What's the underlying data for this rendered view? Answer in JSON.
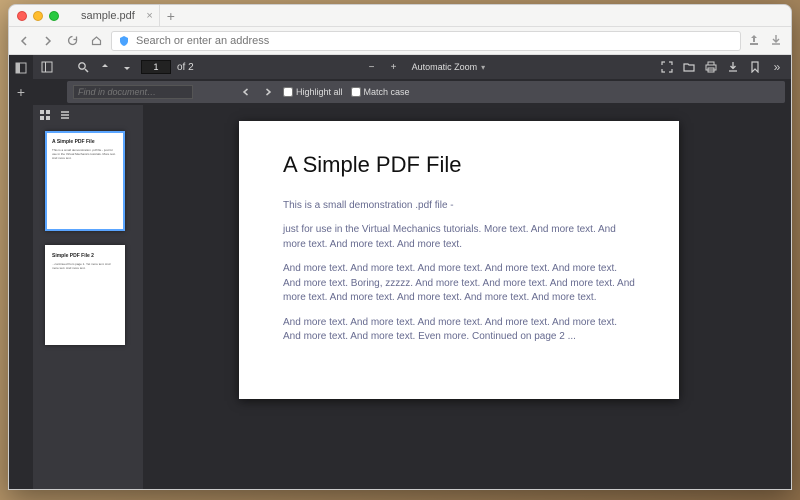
{
  "browser": {
    "tab_title": "sample.pdf",
    "address_placeholder": "Search or enter an address"
  },
  "pdf_toolbar": {
    "page_current": "1",
    "page_total_label": "of 2",
    "zoom_label": "Automatic Zoom"
  },
  "findbar": {
    "placeholder": "Find in document…",
    "highlight_label": "Highlight all",
    "matchcase_label": "Match case"
  },
  "thumbnails": [
    {
      "title": "A Simple PDF File",
      "snippet": "This is a small demonstration .pdf file - just for use in the Virtual Mechanics tutorials. More text. And more text."
    },
    {
      "title": "Simple PDF File 2",
      "snippet": "...continued from page 1. Yet more text. And more text. And more text."
    }
  ],
  "document": {
    "title": "A Simple PDF File",
    "p1": "This is a small demonstration .pdf file -",
    "p2": "just for use in the Virtual Mechanics tutorials. More text. And more text. And more text. And more text. And more text.",
    "p3": "And more text. And more text. And more text. And more text. And more text. And more text. Boring, zzzzz. And more text. And more text. And more text. And more text. And more text. And more text. And more text. And more text.",
    "p4": "And more text. And more text. And more text. And more text. And more text. And more text. And more text. Even more. Continued on page 2 ..."
  }
}
